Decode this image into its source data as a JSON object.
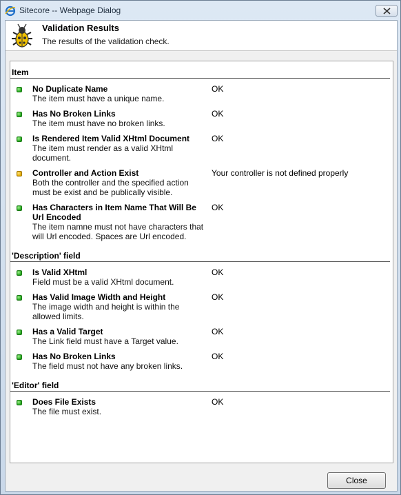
{
  "window": {
    "title": "Sitecore -- Webpage Dialog"
  },
  "header": {
    "title": "Validation Results",
    "subtitle": "The results of the validation check."
  },
  "sections": [
    {
      "title": "Item",
      "rows": [
        {
          "name": "No Duplicate Name",
          "desc": "The item must have a unique name.",
          "result": "OK",
          "status": "ok"
        },
        {
          "name": "Has No Broken Links",
          "desc": "The item must have no broken links.",
          "result": "OK",
          "status": "ok"
        },
        {
          "name": "Is Rendered Item Valid XHtml Document",
          "desc": "The item must render as a valid XHtml document.",
          "result": "OK",
          "status": "ok"
        },
        {
          "name": "Controller and Action Exist",
          "desc": "Both the controller and the specified action must be exist and be publically visible.",
          "result": "Your controller is not defined properly",
          "status": "warn"
        },
        {
          "name": "Has Characters in Item Name That Will Be Url Encoded",
          "desc": "The item namne must not have characters that will Url encoded. Spaces are Url encoded.",
          "result": "OK",
          "status": "ok"
        }
      ]
    },
    {
      "title": "'Description' field",
      "rows": [
        {
          "name": "Is Valid XHtml",
          "desc": "Field must be a valid XHtml document.",
          "result": "OK",
          "status": "ok"
        },
        {
          "name": "Has Valid Image Width and Height",
          "desc": "The image width and height is within the allowed limits.",
          "result": "OK",
          "status": "ok"
        },
        {
          "name": "Has a Valid Target",
          "desc": "The Link field must have a Target value.",
          "result": "OK",
          "status": "ok"
        },
        {
          "name": "Has No Broken Links",
          "desc": "The field must not have any broken links.",
          "result": "OK",
          "status": "ok"
        }
      ]
    },
    {
      "title": "'Editor' field",
      "rows": [
        {
          "name": "Does File Exists",
          "desc": "The file must exist.",
          "result": "OK",
          "status": "ok"
        }
      ]
    }
  ],
  "footer": {
    "close_label": "Close"
  },
  "colors": {
    "ok": "#21a31b",
    "warn": "#e0a800"
  },
  "icons": {
    "titlebar": "ie-icon",
    "header": "bug-icon",
    "window_close": "close-icon"
  }
}
